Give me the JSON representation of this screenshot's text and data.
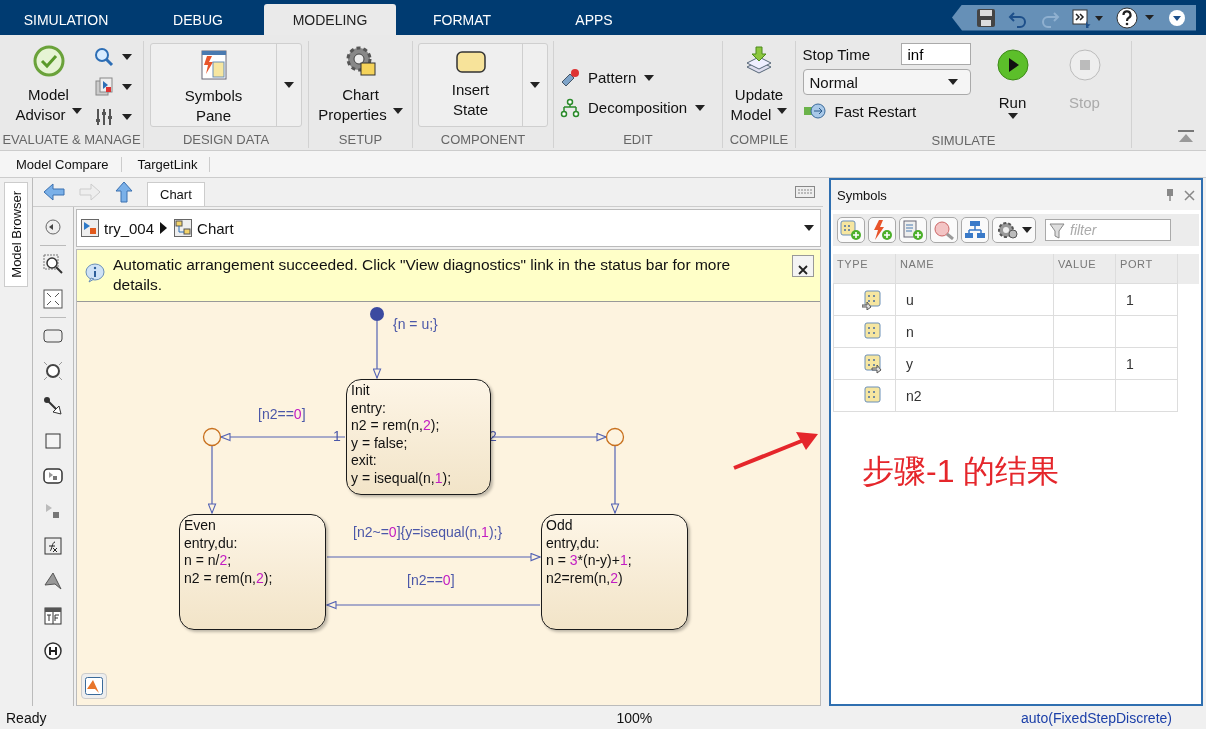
{
  "tabs": [
    {
      "label": "SIMULATION",
      "selected": false
    },
    {
      "label": "DEBUG",
      "selected": false
    },
    {
      "label": "MODELING",
      "selected": true
    },
    {
      "label": "FORMAT",
      "selected": false
    },
    {
      "label": "APPS",
      "selected": false
    }
  ],
  "ribbon": {
    "evaluate": {
      "label": "EVALUATE & MANAGE",
      "advisor": [
        "Model",
        "Advisor"
      ]
    },
    "design": {
      "label": "DESIGN DATA",
      "symbols": [
        "Symbols",
        "Pane"
      ]
    },
    "setup": {
      "label": "SETUP",
      "properties": [
        "Chart",
        "Properties"
      ]
    },
    "component": {
      "label": "COMPONENT",
      "insert": [
        "Insert",
        "State"
      ]
    },
    "edit": {
      "label": "EDIT",
      "items": [
        "Pattern",
        "Decomposition"
      ]
    },
    "compile": {
      "label": "COMPILE",
      "update": [
        "Update",
        "Model"
      ]
    },
    "simulate": {
      "label": "SIMULATE",
      "stop_time_label": "Stop Time",
      "stop_time": "inf",
      "mode": "Normal",
      "fast_restart": "Fast Restart",
      "run": "Run",
      "stop": {
        "label": "Stop",
        "disabled": true
      }
    }
  },
  "sub_toolbar": [
    "Model Compare",
    "TargetLink"
  ],
  "side_tab": "Model Browser",
  "editor": {
    "tab": "Chart",
    "breadcrumb": [
      "try_004",
      "Chart"
    ],
    "banner": "Automatic arrangement succeeded. Click \"View diagnostics\" link in the status bar for more details.",
    "states": [
      {
        "name": "Init",
        "lines": [
          [
            "entry:"
          ],
          [
            "n2 = rem(n,",
            "2",
            ");"
          ],
          [
            "y = false;"
          ],
          [
            "exit:"
          ],
          [
            "y = isequal(n,",
            "1",
            ");"
          ]
        ]
      },
      {
        "name": "Even",
        "lines": [
          [
            "entry,du:"
          ],
          [
            "n = n/",
            "2",
            ";"
          ],
          [
            "n2 = rem(n,",
            "2",
            ");"
          ]
        ]
      },
      {
        "name": "Odd",
        "lines": [
          [
            "entry,du:"
          ],
          [
            "n = ",
            "3",
            "*(n-y)+",
            "1",
            ";"
          ],
          [
            "n2=rem(n,",
            "2",
            ")"
          ]
        ]
      }
    ],
    "transition_labels": [
      [
        "{n = u;}"
      ],
      [
        "[n2==",
        "0",
        "]"
      ],
      [
        "1"
      ],
      [
        "2"
      ],
      [
        "[n2~=",
        "0",
        "]{y=isequal(n,",
        "1",
        ");}"
      ],
      [
        "[n2==",
        "0",
        "]"
      ]
    ]
  },
  "symbols": {
    "title": "Symbols",
    "filter_placeholder": "filter",
    "columns": [
      "TYPE",
      "NAME",
      "VALUE",
      "PORT"
    ],
    "rows": [
      {
        "kind": "input",
        "name": "u",
        "port": "1"
      },
      {
        "kind": "local",
        "name": "n"
      },
      {
        "kind": "output",
        "name": "y",
        "port": "1"
      },
      {
        "kind": "local",
        "name": "n2"
      }
    ]
  },
  "annotation": "步骤-1 的结果",
  "status": {
    "state": "Ready",
    "zoom": "100%",
    "solver": "auto(FixedStepDiscrete)"
  }
}
